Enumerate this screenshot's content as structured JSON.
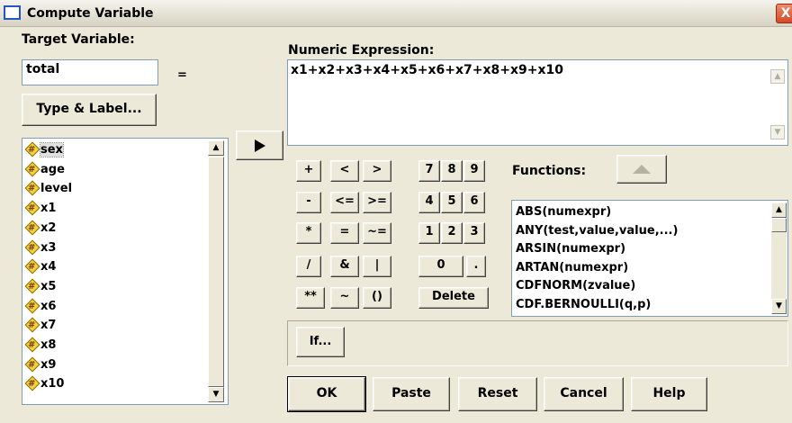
{
  "window": {
    "title": "Compute Variable",
    "close_glyph": "X"
  },
  "target": {
    "label": "Target Variable:",
    "value": "total",
    "equals": "=",
    "type_label_button": "Type & Label..."
  },
  "expression": {
    "label": "Numeric Expression:",
    "value": "x1+x2+x3+x4+x5+x6+x7+x8+x9+x10"
  },
  "move_button": {
    "icon": "right-triangle-icon"
  },
  "variables": [
    "sex",
    "age",
    "level",
    "x1",
    "x2",
    "x3",
    "x4",
    "x5",
    "x6",
    "x7",
    "x8",
    "x9",
    "x10"
  ],
  "selected_variable": "sex",
  "keypad": {
    "plus": "+",
    "lt": "<",
    "gt": ">",
    "k7": "7",
    "k8": "8",
    "k9": "9",
    "minus": "-",
    "le": "<=",
    "ge": ">=",
    "k4": "4",
    "k5": "5",
    "k6": "6",
    "mult": "*",
    "eq": "=",
    "ne": "~=",
    "k1": "1",
    "k2": "2",
    "k3": "3",
    "div": "/",
    "and": "&",
    "or": "|",
    "k0": "0",
    "dot": ".",
    "pow": "**",
    "not": "~",
    "parens": "()",
    "delete": "Delete"
  },
  "functions": {
    "label": "Functions:",
    "items": [
      "ABS(numexpr)",
      "ANY(test,value,value,...)",
      "ARSIN(numexpr)",
      "ARTAN(numexpr)",
      "CDFNORM(zvalue)",
      "CDF.BERNOULLI(q,p)"
    ]
  },
  "buttons": {
    "if": "If...",
    "ok": "OK",
    "paste": "Paste",
    "reset": "Reset",
    "cancel": "Cancel",
    "help": "Help"
  },
  "colors": {
    "dialog_bg": "#ece9d8",
    "field_border": "#7f9db9",
    "icon_yellow": "#f3d33d",
    "close_red": "#d44a26"
  }
}
